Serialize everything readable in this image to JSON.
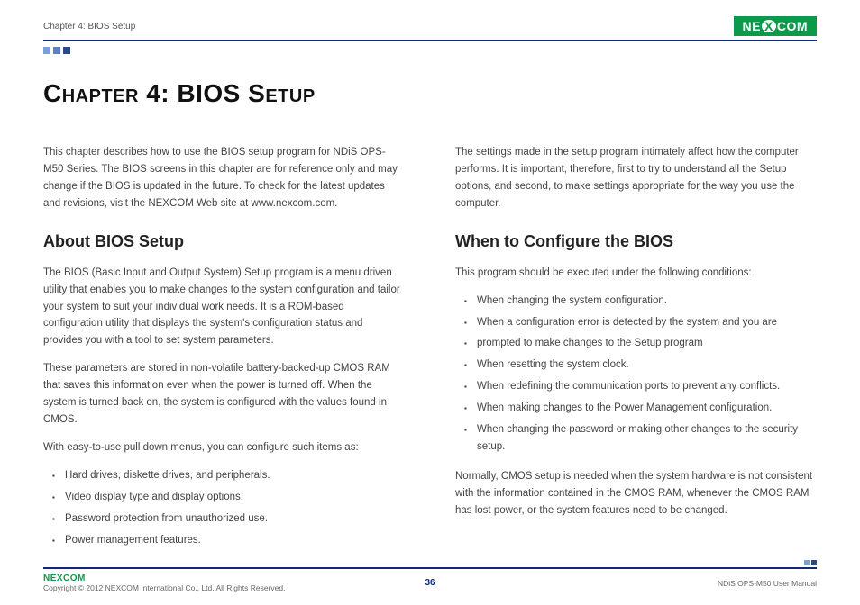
{
  "header": {
    "chapter_label": "Chapter 4: BIOS Setup",
    "logo_text_left": "NE",
    "logo_text_x": "X",
    "logo_text_right": "COM"
  },
  "title": "Chapter 4: BIOS Setup",
  "left": {
    "intro": "This chapter describes how to use the BIOS setup program for NDiS OPS-M50 Series. The BIOS screens in this chapter are for reference only and may change if the BIOS is updated in the future. To check for the latest updates and revisions, visit the NEXCOM Web site at www.nexcom.com.",
    "h_about": "About BIOS Setup",
    "about_p1": "The BIOS (Basic Input and Output System) Setup program is a menu driven utility that enables you to make changes to the system configuration and tailor your system to suit your individual work needs. It is a ROM-based configuration utility that displays the system's configuration status and provides you with a tool to set system parameters.",
    "about_p2": "These parameters are stored in non-volatile battery-backed-up CMOS RAM that saves this information even when the power is turned off. When the system is turned back on, the system is configured with the values found in CMOS.",
    "about_p3": "With easy-to-use pull down menus, you can configure such items as:",
    "about_items": [
      "Hard drives, diskette drives, and peripherals.",
      "Video display type and display options.",
      "Password protection from unauthorized use.",
      "Power management features."
    ]
  },
  "right": {
    "settings_p": "The settings made in the setup program intimately affect how the computer performs. It is important, therefore, first to try to understand all the Setup options, and second, to make settings appropriate for the way you use the computer.",
    "h_when": "When to Configure the BIOS",
    "when_p1": "This program should be executed under the following conditions:",
    "when_items": [
      "When changing the system configuration.",
      "When a configuration error is detected by the system and you are",
      "prompted to make changes to the Setup program",
      "When resetting the system clock.",
      "When redefining the communication ports to prevent any conflicts.",
      "When making changes to the Power Management configuration.",
      "When changing the password or making other changes to the security setup."
    ],
    "when_p2": "Normally, CMOS setup is needed when the system hardware is not consistent with the information contained in the CMOS RAM, whenever the CMOS RAM has lost power, or the system features need to be changed."
  },
  "footer": {
    "logo": "NEXCOM",
    "copyright": "Copyright © 2012 NEXCOM International Co., Ltd. All Rights Reserved.",
    "page": "36",
    "manual": "NDiS OPS-M50 User Manual"
  }
}
